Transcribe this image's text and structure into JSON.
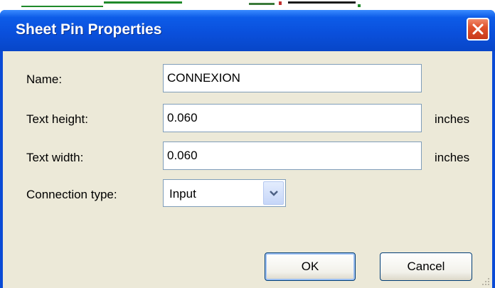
{
  "window": {
    "title": "Sheet Pin Properties"
  },
  "form": {
    "name_label": "Name:",
    "name_value": "CONNEXION",
    "text_height_label": "Text height:",
    "text_height_value": "0.060",
    "text_height_unit": "inches",
    "text_width_label": "Text width:",
    "text_width_value": "0.060",
    "text_width_unit": "inches",
    "connection_type_label": "Connection type:",
    "connection_type_value": "Input"
  },
  "buttons": {
    "ok_label": "OK",
    "cancel_label": "Cancel"
  },
  "colors": {
    "title_bar": "#0a50dc",
    "client_bg": "#ece9d8",
    "close_button": "#e0522c"
  },
  "icons": [
    "close-icon",
    "chevron-down-icon",
    "resize-grip-icon"
  ]
}
